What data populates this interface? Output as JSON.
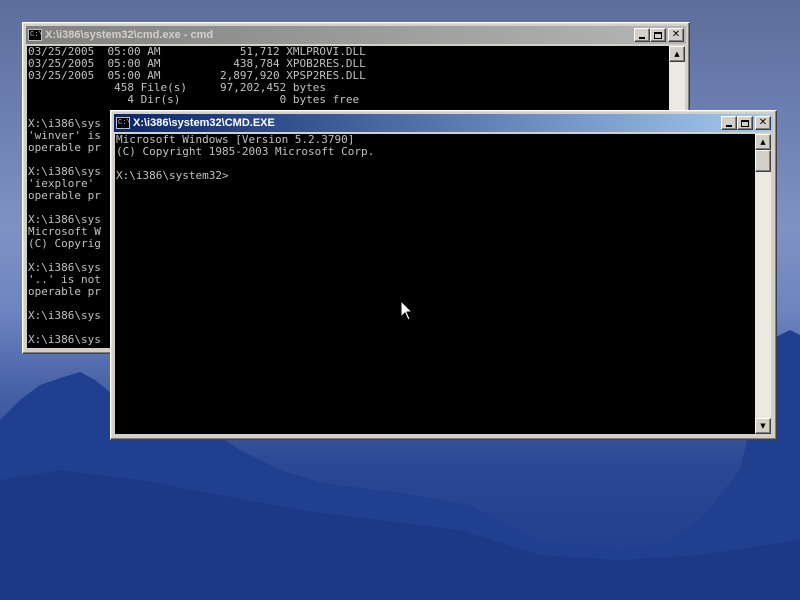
{
  "back_window": {
    "title": "X:\\i386\\system32\\cmd.exe - cmd",
    "icon_label": "C:\\",
    "lines": [
      "03/25/2005  05:00 AM            51,712 XMLPROVI.DLL",
      "03/25/2005  05:00 AM           438,784 XPOB2RES.DLL",
      "03/25/2005  05:00 AM         2,897,920 XPSP2RES.DLL",
      "             458 File(s)     97,202,452 bytes",
      "               4 Dir(s)               0 bytes free",
      "",
      "X:\\i386\\sys",
      "'winver' is",
      "operable pr",
      "",
      "X:\\i386\\sys",
      "'iexplore'",
      "operable pr",
      "",
      "X:\\i386\\sys",
      "Microsoft W",
      "(C) Copyrig",
      "",
      "X:\\i386\\sys",
      "'..' is not",
      "operable pr",
      "",
      "X:\\i386\\sys",
      "",
      "X:\\i386\\sys"
    ]
  },
  "front_window": {
    "title": "X:\\i386\\system32\\CMD.EXE",
    "icon_label": "C:\\",
    "lines": [
      "Microsoft Windows [Version 5.2.3790]",
      "(C) Copyright 1985-2003 Microsoft Corp.",
      "",
      "X:\\i386\\system32>"
    ]
  },
  "icons": {
    "minimize": "minimize-icon",
    "maximize": "maximize-icon",
    "close": "close-icon",
    "scroll_up": "scroll-up-arrow-icon",
    "scroll_down": "scroll-down-arrow-icon",
    "cursor": "mouse-pointer-icon"
  },
  "colors": {
    "console_background": "#000000",
    "console_text": "#c0c0c0",
    "active_title": "#0a246a",
    "inactive_title": "#808080"
  }
}
